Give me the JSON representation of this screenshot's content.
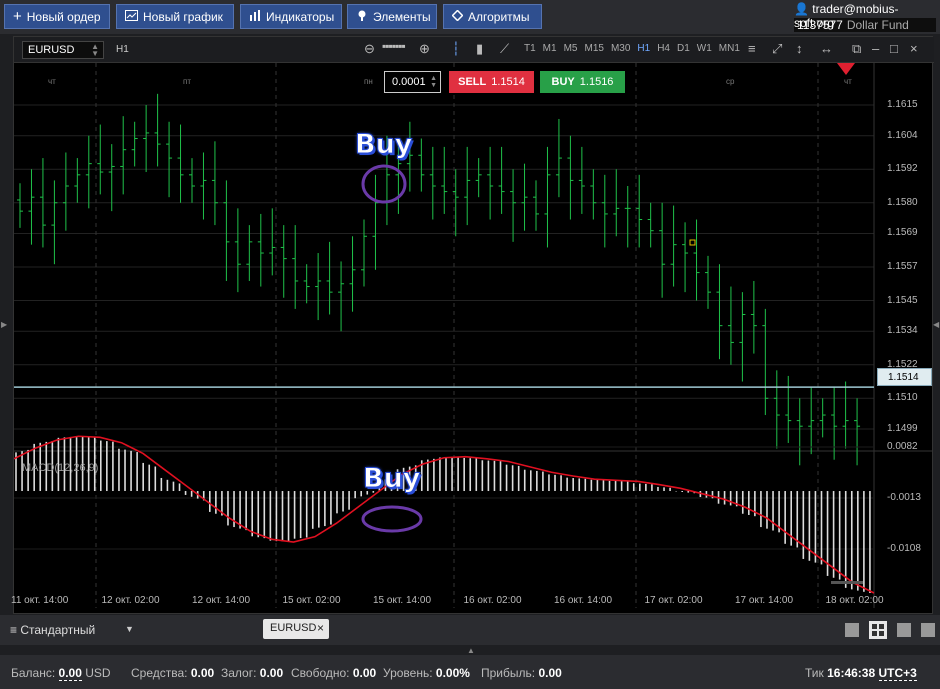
{
  "toolbar": {
    "new_order": "Новый ордер",
    "new_chart": "Новый график",
    "indicators": "Индикаторы",
    "elements": "Элементы",
    "algorithms": "Алгоритмы"
  },
  "account": {
    "user": "trader@mobius-soft.org",
    "number": "1137577",
    "fund": "Dollar Fund"
  },
  "chart": {
    "symbol": "EURUSD",
    "timeframe": "H1",
    "timeframes": [
      "T1",
      "M1",
      "M5",
      "M15",
      "M30",
      "H1",
      "H4",
      "D1",
      "W1",
      "MN1"
    ],
    "active_timeframe": "H1",
    "lot_value": "0.0001",
    "sell_label": "SELL",
    "sell_price": "1.1514",
    "buy_label": "BUY",
    "buy_price": "1.1516",
    "current_price": "1.1514",
    "annotation_top": "Buy",
    "annotation_bottom": "Buy",
    "indicator_label": "MACD(12,26,9)",
    "day_labels": [
      "чт",
      "пт",
      "пн",
      "ср",
      "чт"
    ],
    "colors": {
      "candle": "#1fc24a",
      "macd_signal": "#e01020",
      "histogram": "#dddddd",
      "annotation_circle": "#6a3aa8"
    }
  },
  "chart_data": {
    "type": "line",
    "price_axis_ticks": [
      "1.1615",
      "1.1604",
      "1.1592",
      "1.1580",
      "1.1569",
      "1.1557",
      "1.1545",
      "1.1534",
      "1.1522",
      "1.1510",
      "1.1499"
    ],
    "macd_axis_ticks": [
      "0.0082",
      "-0.0013",
      "-0.0108"
    ],
    "time_axis_labels": [
      "11 окт. 14:00",
      "12 окт. 02:00",
      "12 окт. 14:00",
      "15 окт. 02:00",
      "15 окт. 14:00",
      "16 окт. 02:00",
      "16 окт. 14:00",
      "17 окт. 02:00",
      "17 окт. 14:00",
      "18 окт. 02:00"
    ],
    "close_prices": [
      1.1577,
      1.1582,
      1.1572,
      1.158,
      1.1586,
      1.159,
      1.1594,
      1.1591,
      1.1593,
      1.1599,
      1.1603,
      1.1605,
      1.1601,
      1.1596,
      1.159,
      1.1586,
      1.1588,
      1.158,
      1.1566,
      1.1558,
      1.1566,
      1.1562,
      1.1564,
      1.156,
      1.1552,
      1.155,
      1.1552,
      1.1548,
      1.1551,
      1.1556,
      1.1568,
      1.158,
      1.159,
      1.1594,
      1.1597,
      1.159,
      1.1586,
      1.1584,
      1.1582,
      1.1588,
      1.159,
      1.1586,
      1.1584,
      1.158,
      1.1582,
      1.1576,
      1.159,
      1.1596,
      1.1588,
      1.1586,
      1.158,
      1.1576,
      1.1578,
      1.1578,
      1.1574,
      1.157,
      1.1558,
      1.1565,
      1.1562,
      1.1555,
      1.1548,
      1.1536,
      1.153,
      1.154,
      1.1536,
      1.151,
      1.1504,
      1.1502,
      1.15,
      1.1502,
      1.1504,
      1.15,
      1.1502,
      1.15
    ],
    "macd_signal": [
      0.006,
      0.008,
      0.0095,
      0.0102,
      0.01,
      0.009,
      0.007,
      0.004,
      0.001,
      -0.002,
      -0.005,
      -0.0075,
      -0.009,
      -0.0095,
      -0.0085,
      -0.006,
      -0.003,
      0.0,
      0.003,
      0.005,
      0.0062,
      0.0064,
      0.006,
      0.0055,
      0.0045,
      0.0035,
      0.0028,
      0.0022,
      0.002,
      0.0018,
      0.0012,
      0.0005,
      -0.0005,
      -0.0015,
      -0.003,
      -0.005,
      -0.008,
      -0.011,
      -0.014,
      -0.017,
      -0.019
    ]
  },
  "bottom": {
    "preset": "Стандартный",
    "tab": "EURUSD"
  },
  "status": {
    "balance_label": "Баланс:",
    "balance_value": "0.00",
    "balance_currency": "USD",
    "funds_label": "Средства:",
    "funds_value": "0.00",
    "margin_label": "Залог:",
    "margin_value": "0.00",
    "free_label": "Свободно:",
    "free_value": "0.00",
    "level_label": "Уровень:",
    "level_value": "0.00%",
    "profit_label": "Прибыль:",
    "profit_value": "0.00",
    "tick_label": "Тик",
    "time": "16:46:38",
    "tz": "UTC+3"
  }
}
